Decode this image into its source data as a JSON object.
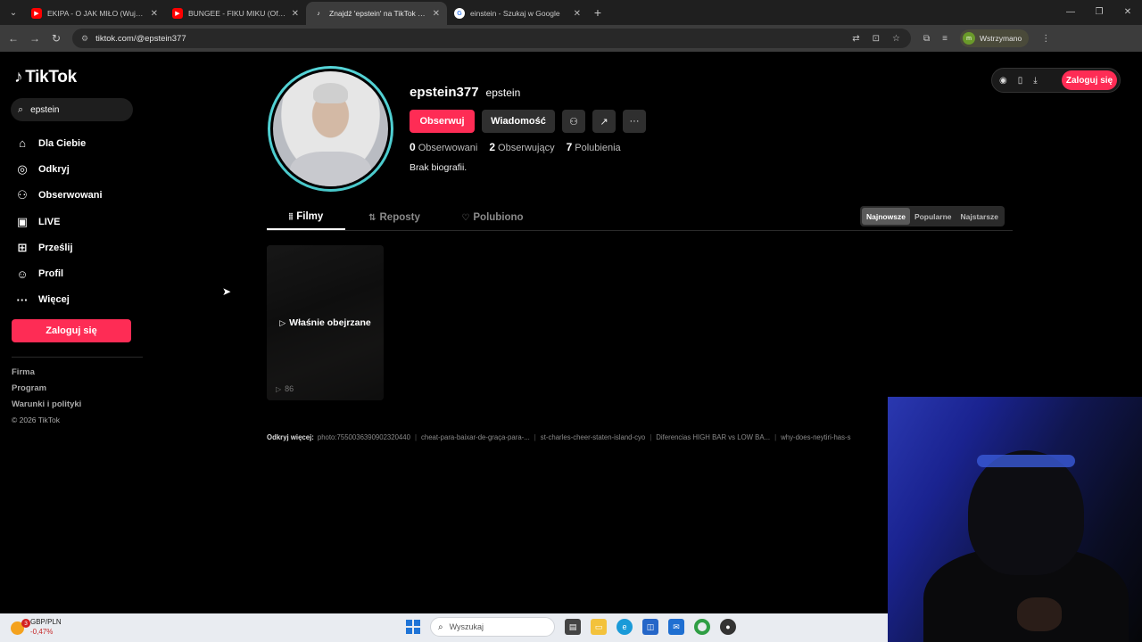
{
  "browser": {
    "tabs": [
      {
        "title": "EKIPA - O JAK MIŁO (Wujas, Mi",
        "favicon": "youtube-icon",
        "active": false
      },
      {
        "title": "BUNGEE - FIKU MIKU (Official V",
        "favicon": "youtube-icon",
        "active": false
      },
      {
        "title": "Znajdź 'epstein' na TikTok | Wy",
        "favicon": "tiktok-icon",
        "active": true
      },
      {
        "title": "einstein - Szukaj w Google",
        "favicon": "google-icon",
        "active": false
      }
    ],
    "url": "tiktok.com/@epstein377",
    "profile_status": "Wstrzymano",
    "profile_initial": "m"
  },
  "sidebar": {
    "logo": "TikTok",
    "search_value": "epstein",
    "nav": [
      {
        "label": "Dla Ciebie",
        "icon": "home-icon"
      },
      {
        "label": "Odkryj",
        "icon": "compass-icon"
      },
      {
        "label": "Obserwowani",
        "icon": "following-icon"
      },
      {
        "label": "LIVE",
        "icon": "live-icon"
      },
      {
        "label": "Prześlij",
        "icon": "upload-icon"
      },
      {
        "label": "Profil",
        "icon": "profile-icon"
      },
      {
        "label": "Więcej",
        "icon": "more-icon"
      }
    ],
    "login_label": "Zaloguj się",
    "footer": [
      "Firma",
      "Program",
      "Warunki i polityki"
    ],
    "copyright": "© 2026 TikTok"
  },
  "header": {
    "login_label": "Zaloguj się"
  },
  "profile": {
    "handle": "epstein377",
    "name": "epstein",
    "follow_label": "Obserwuj",
    "message_label": "Wiadomość",
    "stats": {
      "following_count": "0",
      "following_label": "Obserwowani",
      "followers_count": "2",
      "followers_label": "Obserwujący",
      "likes_count": "7",
      "likes_label": "Polubienia"
    },
    "bio": "Brak biografii."
  },
  "tabs": {
    "videos": "Filmy",
    "reposts": "Reposty",
    "liked": "Polubiono"
  },
  "sort": {
    "newest": "Najnowsze",
    "popular": "Popularne",
    "oldest": "Najstarsze"
  },
  "video": {
    "overlay": "Właśnie obejrzane",
    "views": "86"
  },
  "discover": {
    "label": "Odkryj więcej:",
    "items": [
      "photo:7550036390902320440",
      "cheat-para-baixar-de-graça-para-...",
      "st-charles-cheer-staten-island-cyo",
      "Diferencias HIGH BAR vs LOW BA...",
      "why-does-neytiri-has-s"
    ]
  },
  "taskbar": {
    "ticker": "GBP/PLN",
    "change": "-0,47%",
    "badge": "3",
    "search_placeholder": "Wyszukaj"
  }
}
